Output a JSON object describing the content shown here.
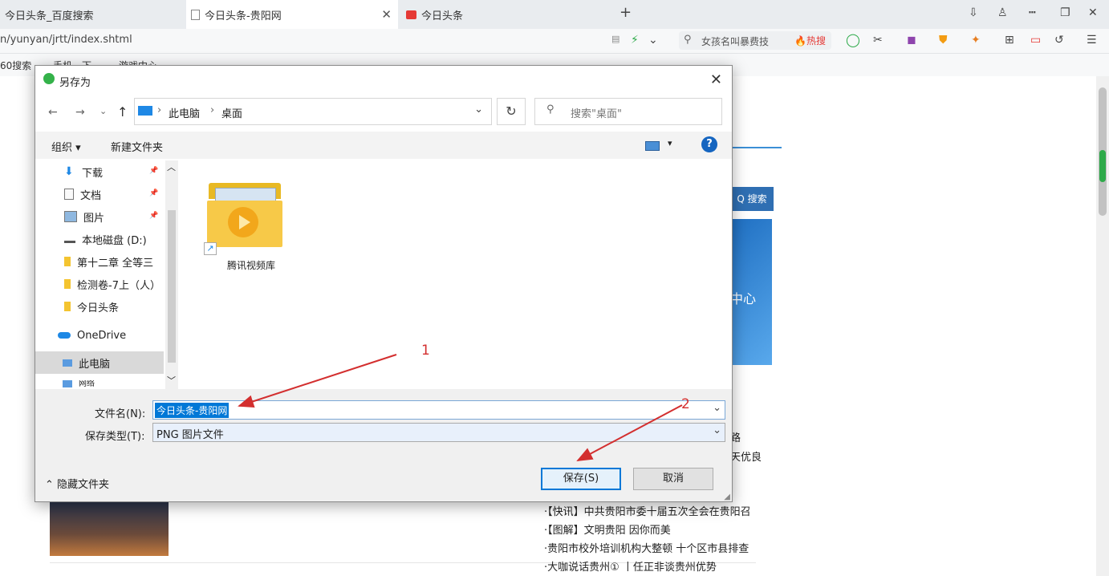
{
  "browser": {
    "tabs": [
      {
        "label": "今日头条_百度搜索"
      },
      {
        "label": "今日头条-贵阳网"
      },
      {
        "label": "今日头条"
      }
    ],
    "new_tab": "+",
    "url": "n/yunyan/jrtt/index.shtml",
    "search_placeholder": "女孩名叫暴费技",
    "hot_label": "热搜",
    "bookmarks": [
      "60搜索",
      "手机一下",
      "游戏中心"
    ]
  },
  "page": {
    "search_button": "Q 搜索",
    "banner_text": "中心",
    "news": [
      "·【快讯】中共贵阳市委十届五次全会在贵阳召",
      "·【图解】文明贵阳  因你而美",
      "·贵阳市校外培训机构大整顿  十个区市县排查",
      "·大咖说话贵州①  丨任正非谈贵州优势"
    ],
    "frag1": "路",
    "frag2": "天优良"
  },
  "dialog": {
    "title": "另存为",
    "nav": {
      "back": "←",
      "forward": "→",
      "recent": "⌄",
      "up": "↑"
    },
    "path": [
      "此电脑",
      "桌面"
    ],
    "search_placeholder": "搜索\"桌面\"",
    "toolbar": {
      "organize": "组织 ▾",
      "new_folder": "新建文件夹",
      "view": "▾",
      "help": "?"
    },
    "tree": [
      {
        "label": "下载",
        "pinned": true
      },
      {
        "label": "文档",
        "pinned": true
      },
      {
        "label": "图片",
        "pinned": true
      },
      {
        "label": "本地磁盘 (D:)"
      },
      {
        "label": "第十二章 全等三"
      },
      {
        "label": "检测卷-7上（人）"
      },
      {
        "label": "今日头条"
      },
      {
        "label": "OneDrive"
      },
      {
        "label": "此电脑"
      },
      {
        "label": "网络"
      }
    ],
    "pin_glyph": "📌",
    "files": [
      {
        "name": "腾讯视频库"
      }
    ],
    "filename_label": "文件名(N):",
    "filename_value": "今日头条-贵阳网",
    "filetype_label": "保存类型(T):",
    "filetype_value": "PNG 图片文件",
    "hide_folders": "隐藏文件夹",
    "save": "保存(S)",
    "cancel": "取消"
  },
  "annotations": {
    "arrow1": "1",
    "arrow2": "2",
    "color": "#d32f2f"
  },
  "colors": {
    "accent": "#0078d7",
    "folder": "#f4c430",
    "selection": "#0078d7"
  }
}
